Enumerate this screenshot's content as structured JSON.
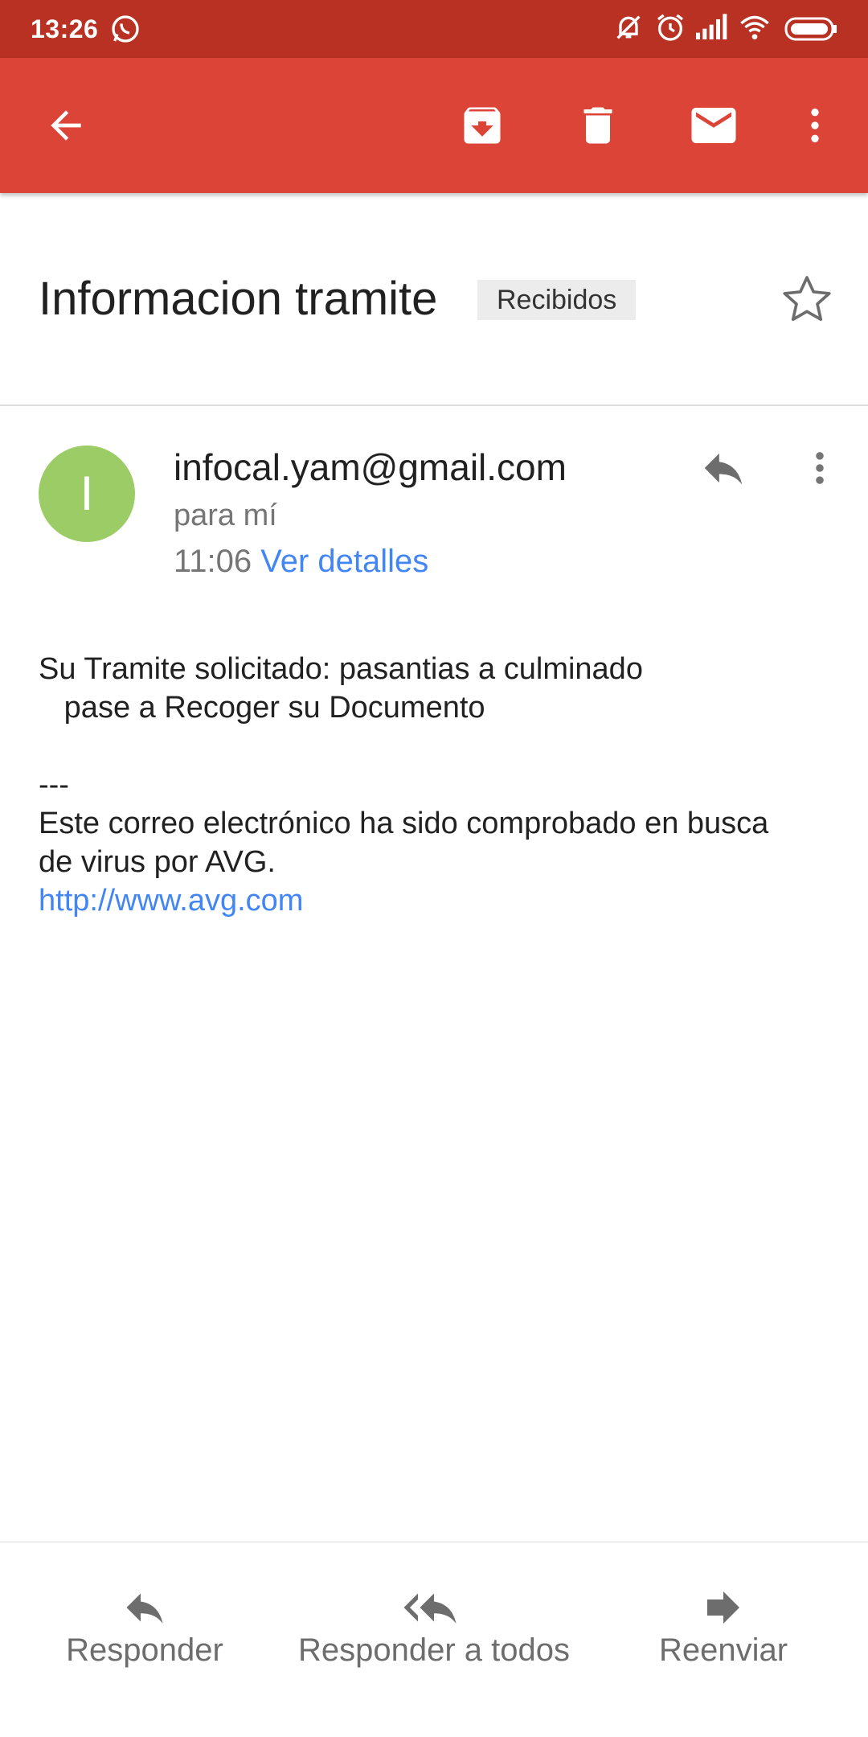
{
  "status_bar": {
    "time": "13:26",
    "icons": [
      "whatsapp-icon",
      "bell-off-icon",
      "alarm-icon",
      "signal-icon",
      "wifi-icon",
      "battery-icon"
    ]
  },
  "toolbar": {
    "icons": [
      "back-arrow-icon",
      "archive-icon",
      "delete-icon",
      "mark-unread-icon",
      "more-vert-icon"
    ]
  },
  "subject": {
    "title": "Informacion tramite",
    "label": "Recibidos"
  },
  "message": {
    "avatar_letter": "I",
    "sender": "infocal.yam@gmail.com",
    "recipient": "para mí",
    "time": "11:06",
    "details_link": "Ver detalles",
    "body": {
      "line1": "Su Tramite solicitado: pasantias a culminado",
      "line2": "   pase a Recoger su Documento",
      "separator": "---",
      "line3": "Este correo electrónico ha sido comprobado en busca",
      "line4": "de virus por AVG.",
      "link": "http://www.avg.com"
    }
  },
  "actions": {
    "reply": "Responder",
    "reply_all": "Responder a todos",
    "forward": "Reenviar"
  },
  "colors": {
    "toolbar": "#db4437",
    "status_bar": "#b93122",
    "avatar": "#9ccc65",
    "link": "#4285f4"
  }
}
